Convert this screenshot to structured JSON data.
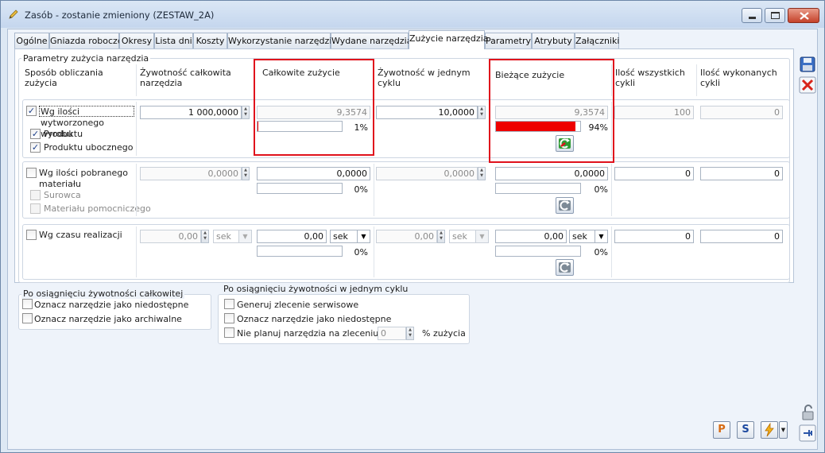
{
  "window": {
    "title": "Zasób - zostanie zmieniony  (ZESTAW_2A)"
  },
  "tabs": [
    "Ogólne",
    "Gniazda robocze",
    "Okresy",
    "Lista dni",
    "Koszty",
    "Wykorzystanie narzędzia",
    "Wydane narzędzia",
    "Zużycie narzędzia",
    "Parametry",
    "Atrybuty",
    "Załączniki"
  ],
  "active_tab": "Zużycie narzędzia",
  "params": {
    "group_title": "Parametry zużycia narzędzia",
    "headers": {
      "method": "Sposób obliczania zużycia",
      "total_life": "Żywotność całkowita narzędzia",
      "total_wear": "Całkowite zużycie",
      "cycle_life": "Żywotność w jednym cyklu",
      "current_wear": "Bieżące zużycie",
      "cycles_count": "Ilość wszystkich cykli",
      "cycles_done": "Ilość wykonanych cykli"
    },
    "row1": {
      "label": "Wg ilości wytworzonego wyrobu",
      "checked": true,
      "sub": [
        {
          "label": "Produktu",
          "checked": true
        },
        {
          "label": "Produktu ubocznego",
          "checked": true
        }
      ],
      "total_life": "1 000,0000",
      "total_wear": "9,3574",
      "total_pct": "1%",
      "total_pct_value": 1,
      "cycle_life": "10,0000",
      "current_wear": "9,3574",
      "current_pct": "94%",
      "current_pct_value": 94,
      "cycles_count": "100",
      "cycles_done": "0"
    },
    "row2": {
      "label": "Wg ilości pobranego materiału",
      "checked": false,
      "sub": [
        {
          "label": "Surowca",
          "checked": false
        },
        {
          "label": "Materiału pomocniczego",
          "checked": false
        }
      ],
      "total_life": "0,0000",
      "total_wear": "0,0000",
      "total_pct": "0%",
      "cycle_life": "0,0000",
      "current_wear": "0,0000",
      "current_pct": "0%",
      "cycles_count": "0",
      "cycles_done": "0"
    },
    "row3": {
      "label": "Wg czasu realizacji",
      "checked": false,
      "total_life": "0,00",
      "total_life_unit": "sek",
      "total_wear": "0,00",
      "total_wear_unit": "sek",
      "total_pct": "0%",
      "cycle_life": "0,00",
      "cycle_life_unit": "sek",
      "current_wear": "0,00",
      "current_wear_unit": "sek",
      "current_pct": "0%",
      "cycles_count": "0",
      "cycles_done": "0"
    }
  },
  "after_total": {
    "title": "Po osiągnięciu żywotności całkowitej",
    "opt1": "Oznacz narzędzie jako niedostępne",
    "opt2": "Oznacz narzędzie jako archiwalne"
  },
  "after_cycle": {
    "title": "Po osiągnięciu żywotności w jednym cyklu",
    "opt1": "Generuj zlecenie serwisowe",
    "opt2": "Oznacz narzędzie jako niedostępne",
    "opt3": "Nie planuj narzędzia na zleceniu od",
    "opt3_value": "0",
    "opt3_suffix": "% zużycia"
  },
  "bottom_buttons": {
    "p": "P",
    "s": "S"
  },
  "colors": {
    "progress": "#ee0000",
    "highlight": "#e0121c"
  }
}
